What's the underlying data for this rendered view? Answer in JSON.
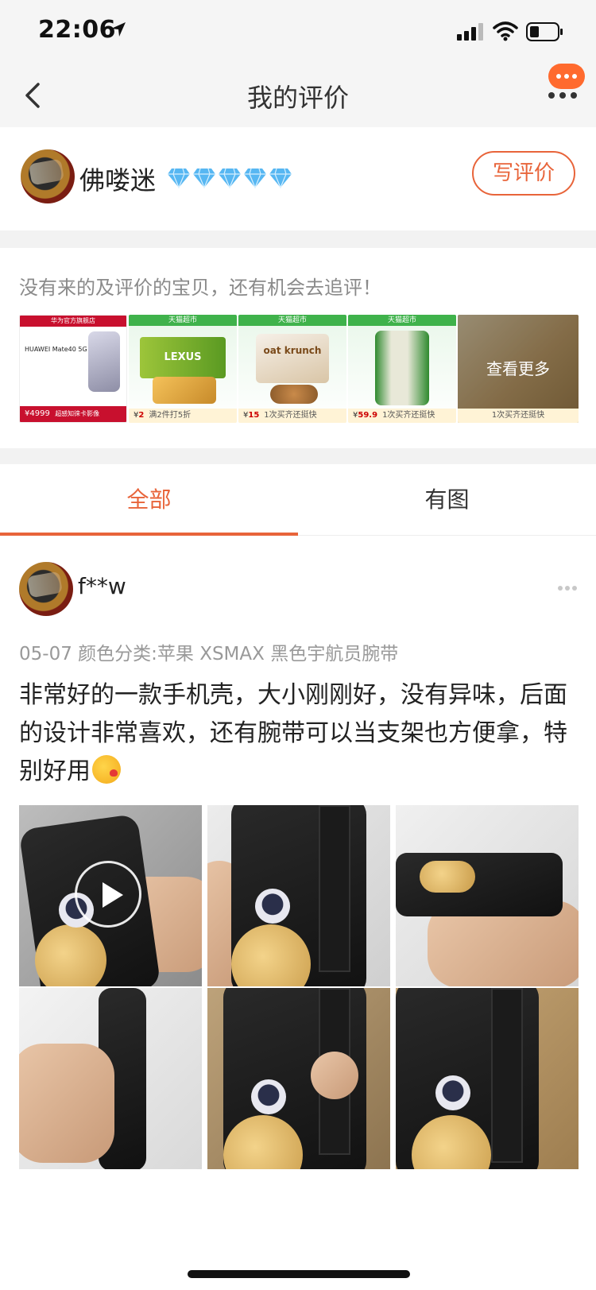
{
  "status_bar": {
    "time": "22:06"
  },
  "nav": {
    "title": "我的评价",
    "back_icon": "chevron-left-icon",
    "more_icon": "more-dots-icon"
  },
  "profile": {
    "username": "佛喽迷",
    "level_icon": "diamond-icon",
    "level_count": 5,
    "write_review_label": "写评价"
  },
  "pending": {
    "text": "没有来的及评价的宝贝，还有机会去追评！",
    "items": [
      {
        "header": "华为官方旗舰店",
        "name": "HUAWEI Mate40 5G",
        "price": "4999",
        "badge": "超感知徕卡影像"
      },
      {
        "header": "天猫超市",
        "name": "LEXUS",
        "price": "2",
        "badge": "满2件打5折"
      },
      {
        "header": "天猫超市",
        "name": "oat krunch",
        "price": "15",
        "badge": "1次买齐还挺快"
      },
      {
        "header": "天猫超市",
        "name": "",
        "price": "59.9",
        "badge": "1次买齐还挺快"
      },
      {
        "header": "",
        "name": "",
        "price": "",
        "badge": "1次买齐还挺快"
      }
    ],
    "view_more_label": "查看更多"
  },
  "tabs": [
    {
      "label": "全部",
      "active": true
    },
    {
      "label": "有图",
      "active": false
    }
  ],
  "review": {
    "reviewer": "f**w",
    "meta": "05-07 颜色分类:苹果 XSMAX 黑色宇航员腕带",
    "text": "非常好的一款手机壳，大小刚刚好，没有异味，后面的设计非常喜欢，还有腕带可以当支架也方便拿，特别好用",
    "emoji": "kissing-face-emoji",
    "photos": [
      {
        "type": "video",
        "icon": "play-icon"
      },
      {
        "type": "image"
      },
      {
        "type": "image"
      },
      {
        "type": "image"
      },
      {
        "type": "image"
      },
      {
        "type": "image"
      }
    ]
  },
  "colors": {
    "accent": "#e8643a",
    "divider": "#f2f2f2",
    "muted_text": "#999999"
  }
}
